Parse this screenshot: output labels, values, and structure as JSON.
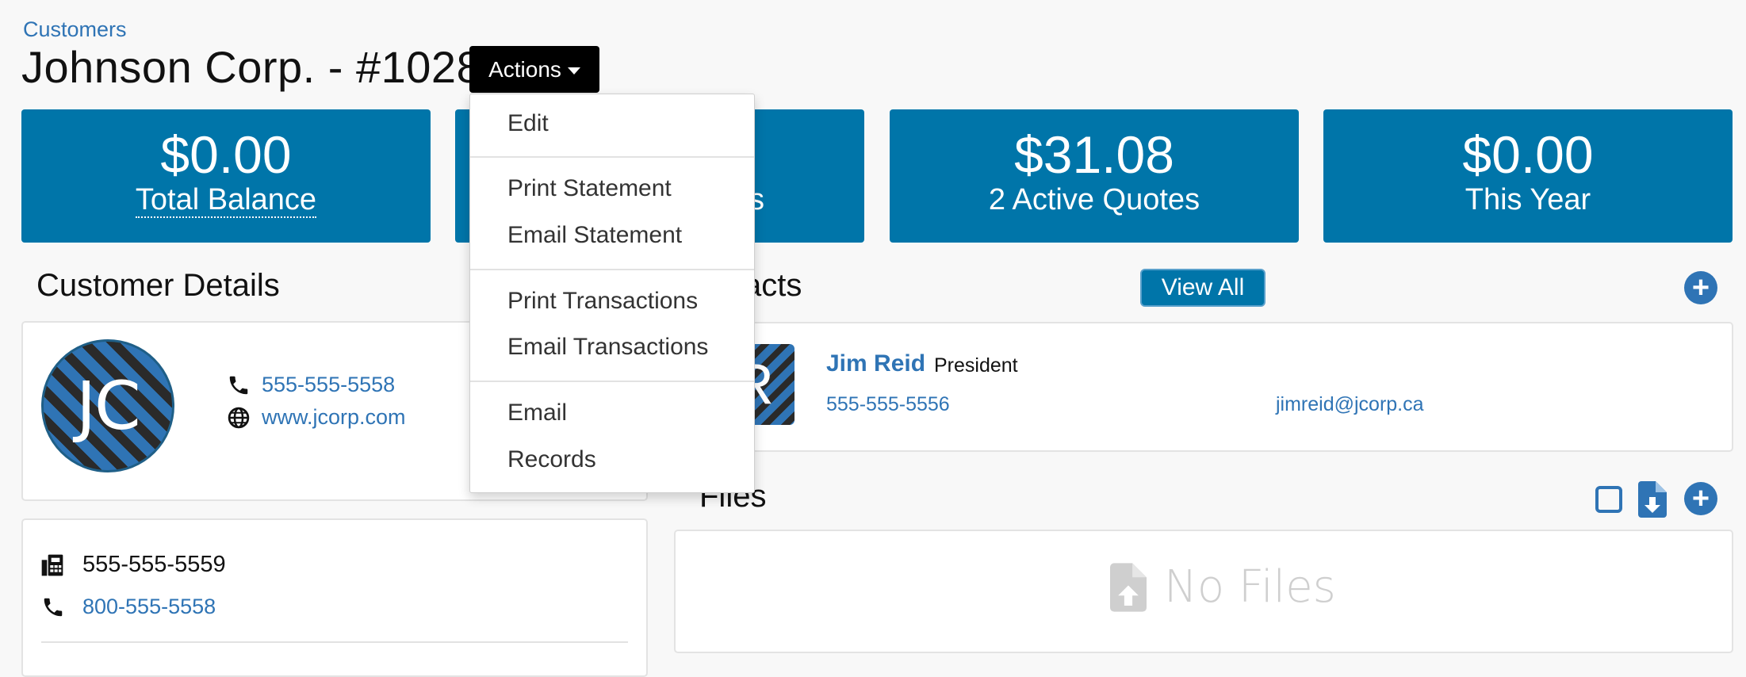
{
  "breadcrumb": "Customers",
  "title": "Johnson Corp. - #1028",
  "actions": {
    "label": "Actions",
    "menu": [
      "Edit",
      "Print Statement",
      "Email Statement",
      "Print Transactions",
      "Email Transactions",
      "Email",
      "Records"
    ]
  },
  "stats": [
    {
      "value": "$0.00",
      "label": "Total Balance"
    },
    {
      "value": "",
      "label": "s"
    },
    {
      "value": "$31.08",
      "label": "2 Active Quotes"
    },
    {
      "value": "$0.00",
      "label": "This Year"
    }
  ],
  "customer_details": {
    "title": "Customer Details",
    "initials": "JC",
    "phone": "555-555-5558",
    "website": "www.jcorp.com",
    "fax": "555-555-5559",
    "toll_free": "800-555-5558"
  },
  "contacts": {
    "title_partial": "acts",
    "view_all": "View All",
    "contact": {
      "initial": "R",
      "name": "Jim Reid",
      "role": "President",
      "phone": "555-555-5556",
      "email": "jimreid@jcorp.ca"
    }
  },
  "files": {
    "title_partial": "Files",
    "empty": "No Files"
  },
  "colors": {
    "accent": "#0075a9",
    "link": "#2f74b5"
  }
}
